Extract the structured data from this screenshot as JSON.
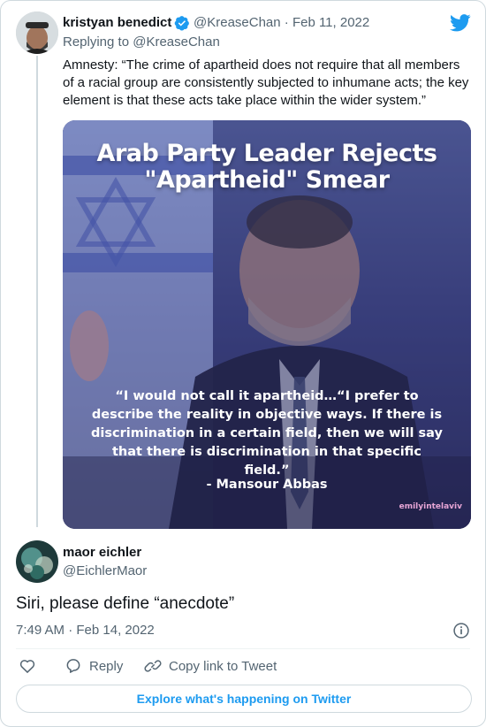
{
  "tweet1": {
    "author_name": "kristyan benedict",
    "handle_date": "@KreaseChan · Feb 11, 2022",
    "replying_to": "Replying to @KreaseChan",
    "text": "Amnesty: “The crime of apartheid does not require that all members of a racial group are consistently subjected to inhumane acts; the key element is that these acts take place within the wider system.”",
    "media": {
      "title_line1": "Arab Party Leader Rejects",
      "title_line2": "\"Apartheid\" Smear",
      "quote": "“I would not call it apartheid…“I prefer to describe the reality in objective ways. If there is discrimination in a certain field, then we will say that there is discrimination in that specific field.”",
      "attribution": "- Mansour Abbas",
      "watermark": "emilyintelaviv"
    }
  },
  "tweet2": {
    "author_name": "maor eichler",
    "handle": "@EichlerMaor",
    "text": "Siri, please define “anecdote”",
    "timestamp": "7:49 AM · Feb 14, 2022"
  },
  "actions": {
    "reply_label": "Reply",
    "copy_link_label": "Copy link to Tweet"
  },
  "explore_label": "Explore what's happening on Twitter",
  "colors": {
    "accent": "#1d9bf0",
    "muted": "#536471",
    "border": "#cfd9de",
    "verified": "#1d9bf0"
  },
  "icons": [
    "twitter-bird-icon",
    "verified-badge-icon",
    "info-icon",
    "heart-icon",
    "reply-icon",
    "link-icon"
  ]
}
